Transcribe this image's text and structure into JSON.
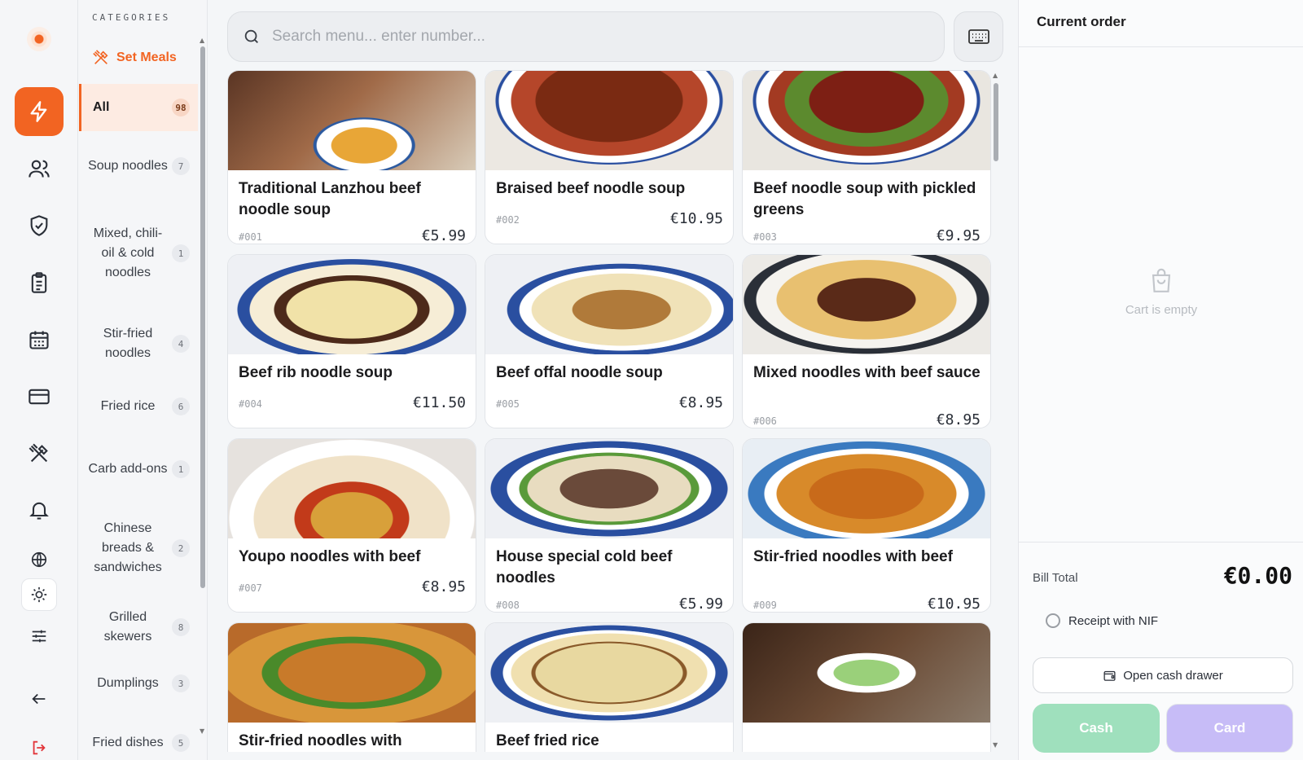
{
  "rail": {
    "icons": [
      "lightning-icon",
      "users-icon",
      "shield-check-icon",
      "clipboard-icon",
      "calendar-icon",
      "credit-card-icon",
      "utensils-crossed-icon",
      "bell-icon",
      "globe-icon",
      "sun-icon",
      "sliders-icon",
      "arrow-left-icon",
      "logout-icon"
    ],
    "accent": "#f26422"
  },
  "categories": {
    "title": "CATEGORIES",
    "set_meals": "Set Meals",
    "items": [
      {
        "label": "All",
        "count": "98"
      },
      {
        "label": "Soup noodles",
        "count": "7"
      },
      {
        "label": "Mixed, chili-oil & cold noodles",
        "count": "1"
      },
      {
        "label": "Stir-fried noodles",
        "count": "4"
      },
      {
        "label": "Fried rice",
        "count": "6"
      },
      {
        "label": "Carb add-ons",
        "count": "1"
      },
      {
        "label": "Chinese breads & sandwiches",
        "count": "2"
      },
      {
        "label": "Grilled skewers",
        "count": "8"
      },
      {
        "label": "Dumplings",
        "count": "3"
      },
      {
        "label": "Fried dishes",
        "count": "5"
      }
    ]
  },
  "search": {
    "placeholder": "Search menu... enter number..."
  },
  "menu": [
    {
      "name": "Traditional Lanzhou beef noodle soup",
      "code": "#001",
      "price": "€5.99"
    },
    {
      "name": "Braised beef noodle soup",
      "code": "#002",
      "price": "€10.95"
    },
    {
      "name": "Beef noodle soup with pickled greens",
      "code": "#003",
      "price": "€9.95"
    },
    {
      "name": "Beef rib noodle soup",
      "code": "#004",
      "price": "€11.50"
    },
    {
      "name": "Beef offal noodle soup",
      "code": "#005",
      "price": "€8.95"
    },
    {
      "name": "Mixed noodles with beef sauce",
      "code": "#006",
      "price": "€8.95"
    },
    {
      "name": "Youpo noodles with beef",
      "code": "#007",
      "price": "€8.95"
    },
    {
      "name": "House special cold beef noodles",
      "code": "#008",
      "price": "€5.99"
    },
    {
      "name": "Stir-fried noodles with beef",
      "code": "#009",
      "price": "€10.95"
    },
    {
      "name": "Stir-fried noodles with",
      "code": "",
      "price": ""
    },
    {
      "name": "Beef fried rice",
      "code": "",
      "price": ""
    },
    {
      "name": "",
      "code": "",
      "price": ""
    }
  ],
  "order": {
    "title": "Current order",
    "empty_text": "Cart is empty",
    "bill_label": "Bill Total",
    "bill_total": "€0.00",
    "receipt_label": "Receipt with NIF",
    "drawer_label": "Open cash drawer",
    "cash_label": "Cash",
    "card_label": "Card"
  }
}
